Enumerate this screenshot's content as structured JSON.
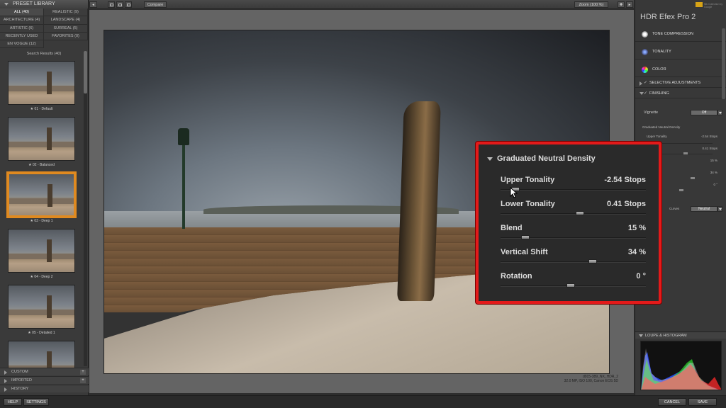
{
  "left_panel": {
    "header": "PRESET LIBRARY",
    "categories": [
      "ALL (40)",
      "REALISTIC (9)",
      "ARCHITECTURE (4)",
      "LANDSCAPE (4)",
      "ARTISTIC (6)",
      "SURREAL (5)",
      "RECENTLY USED",
      "FAVORITES (0)",
      "EN VOGUE (12)"
    ],
    "search_results": "Search Results (40)",
    "thumbnails": [
      "★ 01 - Default",
      "★ 02 - Balanced",
      "★ 03 - Deep 1",
      "★ 04 - Deep 2",
      "★ 05 - Detailed 1",
      ""
    ],
    "custom": "CUSTOM",
    "imported": "IMPORTED",
    "history": "HISTORY",
    "plus": "+"
  },
  "toolbar": {
    "compare": "Compare",
    "zoom": "Zoom (100 %)"
  },
  "canvas": {
    "caption_line1": "d915-389_NX_HDR_2",
    "caption_line2": "32.0 MP, ISO 100, Canon EOS 5D"
  },
  "right_panel": {
    "brand_small": "Nik Collection by Google",
    "title": "HDR Efex Pro 2",
    "sections": [
      "TONE COMPRESSION",
      "TONALITY",
      "COLOR"
    ],
    "subsections": [
      "SELECTIVE ADJUSTMENTS",
      "FINISHING"
    ],
    "vignette_label": "Vignette",
    "vignette_value": "Off",
    "gnd_label": "Graduated Neutral Density",
    "bg_rows": [
      {
        "label": "Upper Tonality",
        "value": "-2.54 Stops"
      },
      {
        "label": "Lower Tonality",
        "value": "0.41 Stops"
      },
      {
        "label": "Blend",
        "value": "15 %"
      },
      {
        "label": "Vertical Shift",
        "value": "34 %"
      },
      {
        "label": "Rotation",
        "value": "0 °"
      }
    ],
    "curves_label": "Curves",
    "curves_value": "Neutral",
    "loupe": "LOUPE & HISTOGRAM"
  },
  "footer": {
    "help": "HELP",
    "settings": "SETTINGS",
    "cancel": "CANCEL",
    "save": "SAVE"
  },
  "gnd_panel": {
    "title": "Graduated Neutral Density",
    "rows": [
      {
        "label": "Upper Tonality",
        "value": "-2.54  Stops",
        "slider": 0.08
      },
      {
        "label": "Lower Tonality",
        "value": "0.41  Stops",
        "slider": 0.55
      },
      {
        "label": "Blend",
        "value": "15 %",
        "slider": 0.15
      },
      {
        "label": "Vertical Shift",
        "value": "34 %",
        "slider": 0.64
      },
      {
        "label": "Rotation",
        "value": "0 °",
        "slider": 0.48
      }
    ]
  },
  "colors": {
    "highlight_border": "#e31a1a",
    "selected_thumb": "#e08a20",
    "brand": "#d7a316"
  }
}
